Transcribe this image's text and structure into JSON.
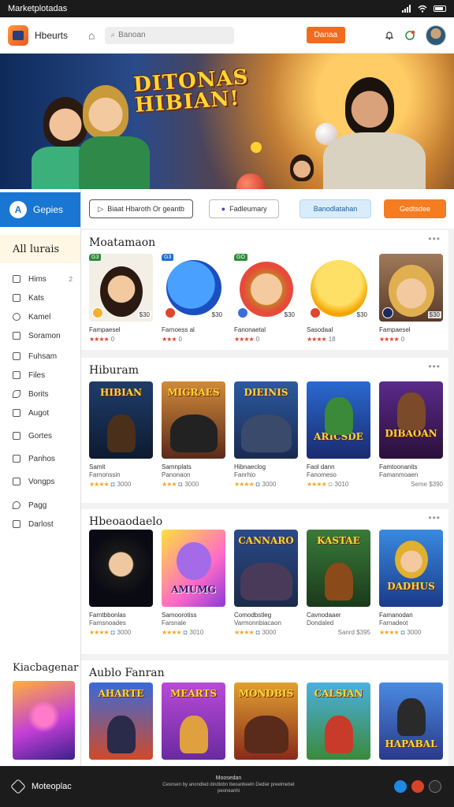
{
  "status_bar": {
    "title": "Marketplotadas"
  },
  "topbar": {
    "app_name": "Hbeurts",
    "search_placeholder": "Banoan",
    "action_button": "Danaa"
  },
  "banner": {
    "title_line1": "DITONAS",
    "title_line2": "HIBIAN!"
  },
  "sidebar": {
    "active_label": "Gepies",
    "active_icon": "A",
    "section_title": "All lurais",
    "items": [
      {
        "label": "Hims",
        "count": "2",
        "icon": "square-icon"
      },
      {
        "label": "Kats",
        "count": "",
        "icon": "image-icon"
      },
      {
        "label": "Kamel",
        "count": "",
        "icon": "clock-icon"
      },
      {
        "label": "Soramon",
        "count": "",
        "icon": "gallery-icon"
      },
      {
        "label": "Fuhsam",
        "count": "",
        "icon": "doc-icon"
      },
      {
        "label": "Files",
        "count": "",
        "icon": "files-icon"
      },
      {
        "label": "Borits",
        "count": "",
        "icon": "brush-icon"
      },
      {
        "label": "Augot",
        "count": "",
        "icon": "gift-icon"
      },
      {
        "label": "Gortes",
        "count": "",
        "icon": "box-icon"
      },
      {
        "label": "Panhos",
        "count": "",
        "icon": "page-icon"
      },
      {
        "label": "Vongps",
        "count": "",
        "icon": "card-icon"
      },
      {
        "label": "Pagg",
        "count": "",
        "icon": "pin-icon"
      },
      {
        "label": "Darlost",
        "count": "",
        "icon": "square-icon"
      }
    ],
    "bottom_title": "Kiacbagenar"
  },
  "filters": [
    {
      "label": "Biaat Hbaroth Or geantb",
      "icon": "play-icon"
    },
    {
      "label": "Fadleumary",
      "icon": "video-icon"
    },
    {
      "label": "Banodlatahan",
      "icon": ""
    },
    {
      "label": "Gedtsdee",
      "icon": ""
    }
  ],
  "sections": [
    {
      "title": "Moatamaon",
      "more": "•••",
      "cards": [
        {
          "name": "Fampaesel",
          "sub": "",
          "stars": "★★★★",
          "rating": "0",
          "price": "$30",
          "tag": "G3"
        },
        {
          "name": "Farnoess al",
          "sub": "",
          "stars": "★★★",
          "rating": "0",
          "price": "$30",
          "tag": "G3"
        },
        {
          "name": "Fanonaetal",
          "sub": "",
          "stars": "★★★★",
          "rating": "0",
          "price": "$30",
          "tag": "GO"
        },
        {
          "name": "Sasodaal",
          "sub": "",
          "stars": "★★★★",
          "rating": "18",
          "price": "$30",
          "tag": ""
        },
        {
          "name": "Fampaesel",
          "sub": "",
          "stars": "★★★★",
          "rating": "0",
          "price": "$30",
          "tag": ""
        }
      ]
    },
    {
      "title": "Hiburam",
      "more": "•••",
      "cards": [
        {
          "name": "Samit",
          "sub": "Farnonssin",
          "stars": "★★★★",
          "rating": "3000",
          "price": "",
          "art": "HIBIAN"
        },
        {
          "name": "Samnplats",
          "sub": "Panonaon",
          "stars": "★★★",
          "rating": "3000",
          "price": "",
          "art": "MIGRAES"
        },
        {
          "name": "Hibnaeclog",
          "sub": "Fanrhio",
          "stars": "★★★★",
          "rating": "3000",
          "price": "",
          "art": "DIEINIS"
        },
        {
          "name": "Faol dann",
          "sub": "Fanomeso",
          "stars": "★★★★",
          "rating": "3010",
          "price": "",
          "art": "ARICSDE"
        },
        {
          "name": "Famtoonanits",
          "sub": "Famanmoaen",
          "stars": "",
          "rating": "Seme $390",
          "price": "",
          "art": "DIBAOAN"
        }
      ]
    },
    {
      "title": "Hbeoaodaelo",
      "more": "•••",
      "cards": [
        {
          "name": "Farntbbonlas",
          "sub": "Farnsnoades",
          "stars": "★★★★",
          "rating": "3000",
          "price": "",
          "art": ""
        },
        {
          "name": "Samoorotiss",
          "sub": "Farsnale",
          "stars": "★★★★",
          "rating": "3010",
          "price": "",
          "art": "AMUMG"
        },
        {
          "name": "Comodbstleg",
          "sub": "Varmonnbiacaon",
          "stars": "★★★★",
          "rating": "3000",
          "price": "",
          "art": "CANNARO"
        },
        {
          "name": "Cavnodaaer",
          "sub": "Dondaled",
          "stars": "",
          "rating": "Sanrd $395",
          "price": "",
          "art": "KASTAE"
        },
        {
          "name": "Famanodan",
          "sub": "Farnadeot",
          "stars": "★★★★",
          "rating": "3000",
          "price": "",
          "art": "DADHUS"
        }
      ]
    },
    {
      "title": "Aublo Fanran",
      "more": "",
      "cards": [
        {
          "name": "",
          "sub": "",
          "stars": "",
          "rating": "",
          "price": "",
          "art": "AHARTE"
        },
        {
          "name": "",
          "sub": "",
          "stars": "",
          "rating": "",
          "price": "",
          "art": "MEARTS"
        },
        {
          "name": "",
          "sub": "",
          "stars": "",
          "rating": "",
          "price": "",
          "art": "MONDBIS"
        },
        {
          "name": "",
          "sub": "",
          "stars": "",
          "rating": "",
          "price": "",
          "art": "CALSIAN"
        },
        {
          "name": "",
          "sub": "",
          "stars": "",
          "rating": "",
          "price": "",
          "art": "HAPABAL"
        }
      ]
    }
  ],
  "bottom_bar": {
    "app_name": "Moteoplac",
    "center_title": "Moosedan",
    "center_line": "Cesnsen by anondted dindlobn tiwoanbeeln Dedier preelmebet",
    "center_line2": "peoneanhi"
  }
}
